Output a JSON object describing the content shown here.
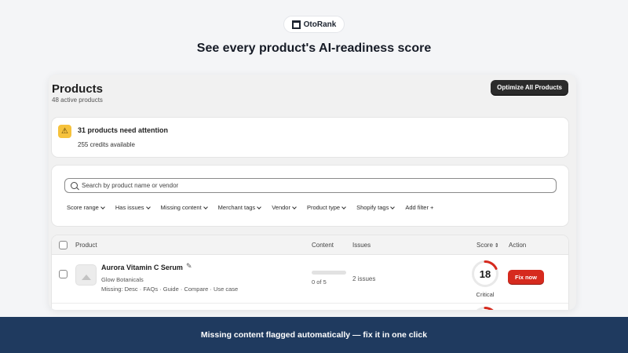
{
  "brand": {
    "name": "OtoRank"
  },
  "headline": "See every product's AI-readiness score",
  "products": {
    "title": "Products",
    "subtitle": "48 active products",
    "optimize_label": "Optimize All Products"
  },
  "attention": {
    "title": "31 products need attention",
    "credits": "255 credits available"
  },
  "search": {
    "placeholder": "Search by product name or vendor"
  },
  "filters": [
    "Score range",
    "Has issues",
    "Missing content",
    "Merchant tags",
    "Vendor",
    "Product type",
    "Shopify tags",
    "Add filter +"
  ],
  "table": {
    "headers": {
      "product": "Product",
      "content": "Content",
      "issues": "Issues",
      "score": "Score",
      "action": "Action"
    },
    "rows": [
      {
        "name": "Aurora Vitamin C Serum",
        "vendor": "Glow Botanicals",
        "missing": "Missing: Desc · FAQs · Guide · Compare · Use case",
        "content": "0 of 5",
        "content_fraction": 0,
        "issues": "2 issues",
        "score": "18",
        "score_label": "Critical",
        "action": "Fix now"
      }
    ]
  },
  "colors": {
    "critical": "#d62a1e",
    "warning": "#f6c23c",
    "banner": "#1f3a5f"
  },
  "banner": "Missing content flagged automatically — fix it in one click"
}
